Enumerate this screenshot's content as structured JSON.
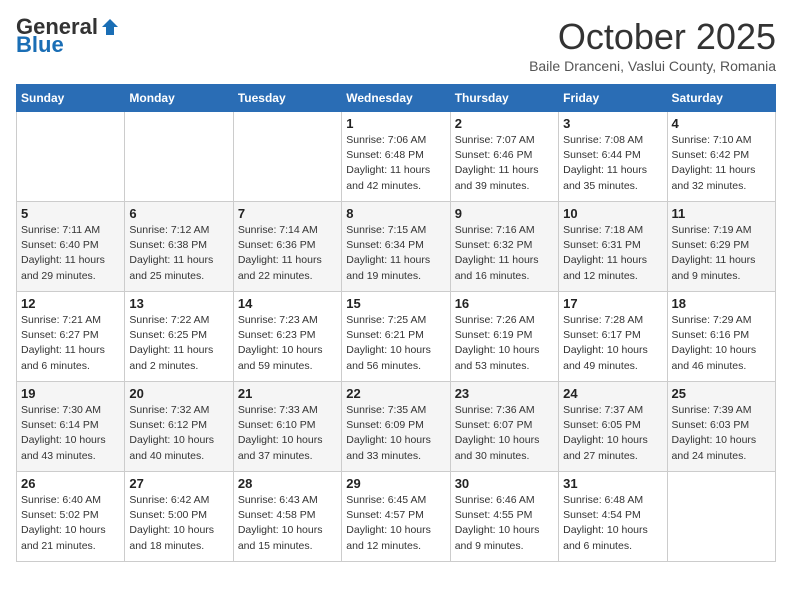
{
  "header": {
    "logo_general": "General",
    "logo_blue": "Blue",
    "month_title": "October 2025",
    "location": "Baile Dranceni, Vaslui County, Romania"
  },
  "weekdays": [
    "Sunday",
    "Monday",
    "Tuesday",
    "Wednesday",
    "Thursday",
    "Friday",
    "Saturday"
  ],
  "weeks": [
    [
      {
        "day": "",
        "info": ""
      },
      {
        "day": "",
        "info": ""
      },
      {
        "day": "",
        "info": ""
      },
      {
        "day": "1",
        "info": "Sunrise: 7:06 AM\nSunset: 6:48 PM\nDaylight: 11 hours and 42 minutes."
      },
      {
        "day": "2",
        "info": "Sunrise: 7:07 AM\nSunset: 6:46 PM\nDaylight: 11 hours and 39 minutes."
      },
      {
        "day": "3",
        "info": "Sunrise: 7:08 AM\nSunset: 6:44 PM\nDaylight: 11 hours and 35 minutes."
      },
      {
        "day": "4",
        "info": "Sunrise: 7:10 AM\nSunset: 6:42 PM\nDaylight: 11 hours and 32 minutes."
      }
    ],
    [
      {
        "day": "5",
        "info": "Sunrise: 7:11 AM\nSunset: 6:40 PM\nDaylight: 11 hours and 29 minutes."
      },
      {
        "day": "6",
        "info": "Sunrise: 7:12 AM\nSunset: 6:38 PM\nDaylight: 11 hours and 25 minutes."
      },
      {
        "day": "7",
        "info": "Sunrise: 7:14 AM\nSunset: 6:36 PM\nDaylight: 11 hours and 22 minutes."
      },
      {
        "day": "8",
        "info": "Sunrise: 7:15 AM\nSunset: 6:34 PM\nDaylight: 11 hours and 19 minutes."
      },
      {
        "day": "9",
        "info": "Sunrise: 7:16 AM\nSunset: 6:32 PM\nDaylight: 11 hours and 16 minutes."
      },
      {
        "day": "10",
        "info": "Sunrise: 7:18 AM\nSunset: 6:31 PM\nDaylight: 11 hours and 12 minutes."
      },
      {
        "day": "11",
        "info": "Sunrise: 7:19 AM\nSunset: 6:29 PM\nDaylight: 11 hours and 9 minutes."
      }
    ],
    [
      {
        "day": "12",
        "info": "Sunrise: 7:21 AM\nSunset: 6:27 PM\nDaylight: 11 hours and 6 minutes."
      },
      {
        "day": "13",
        "info": "Sunrise: 7:22 AM\nSunset: 6:25 PM\nDaylight: 11 hours and 2 minutes."
      },
      {
        "day": "14",
        "info": "Sunrise: 7:23 AM\nSunset: 6:23 PM\nDaylight: 10 hours and 59 minutes."
      },
      {
        "day": "15",
        "info": "Sunrise: 7:25 AM\nSunset: 6:21 PM\nDaylight: 10 hours and 56 minutes."
      },
      {
        "day": "16",
        "info": "Sunrise: 7:26 AM\nSunset: 6:19 PM\nDaylight: 10 hours and 53 minutes."
      },
      {
        "day": "17",
        "info": "Sunrise: 7:28 AM\nSunset: 6:17 PM\nDaylight: 10 hours and 49 minutes."
      },
      {
        "day": "18",
        "info": "Sunrise: 7:29 AM\nSunset: 6:16 PM\nDaylight: 10 hours and 46 minutes."
      }
    ],
    [
      {
        "day": "19",
        "info": "Sunrise: 7:30 AM\nSunset: 6:14 PM\nDaylight: 10 hours and 43 minutes."
      },
      {
        "day": "20",
        "info": "Sunrise: 7:32 AM\nSunset: 6:12 PM\nDaylight: 10 hours and 40 minutes."
      },
      {
        "day": "21",
        "info": "Sunrise: 7:33 AM\nSunset: 6:10 PM\nDaylight: 10 hours and 37 minutes."
      },
      {
        "day": "22",
        "info": "Sunrise: 7:35 AM\nSunset: 6:09 PM\nDaylight: 10 hours and 33 minutes."
      },
      {
        "day": "23",
        "info": "Sunrise: 7:36 AM\nSunset: 6:07 PM\nDaylight: 10 hours and 30 minutes."
      },
      {
        "day": "24",
        "info": "Sunrise: 7:37 AM\nSunset: 6:05 PM\nDaylight: 10 hours and 27 minutes."
      },
      {
        "day": "25",
        "info": "Sunrise: 7:39 AM\nSunset: 6:03 PM\nDaylight: 10 hours and 24 minutes."
      }
    ],
    [
      {
        "day": "26",
        "info": "Sunrise: 6:40 AM\nSunset: 5:02 PM\nDaylight: 10 hours and 21 minutes."
      },
      {
        "day": "27",
        "info": "Sunrise: 6:42 AM\nSunset: 5:00 PM\nDaylight: 10 hours and 18 minutes."
      },
      {
        "day": "28",
        "info": "Sunrise: 6:43 AM\nSunset: 4:58 PM\nDaylight: 10 hours and 15 minutes."
      },
      {
        "day": "29",
        "info": "Sunrise: 6:45 AM\nSunset: 4:57 PM\nDaylight: 10 hours and 12 minutes."
      },
      {
        "day": "30",
        "info": "Sunrise: 6:46 AM\nSunset: 4:55 PM\nDaylight: 10 hours and 9 minutes."
      },
      {
        "day": "31",
        "info": "Sunrise: 6:48 AM\nSunset: 4:54 PM\nDaylight: 10 hours and 6 minutes."
      },
      {
        "day": "",
        "info": ""
      }
    ]
  ]
}
